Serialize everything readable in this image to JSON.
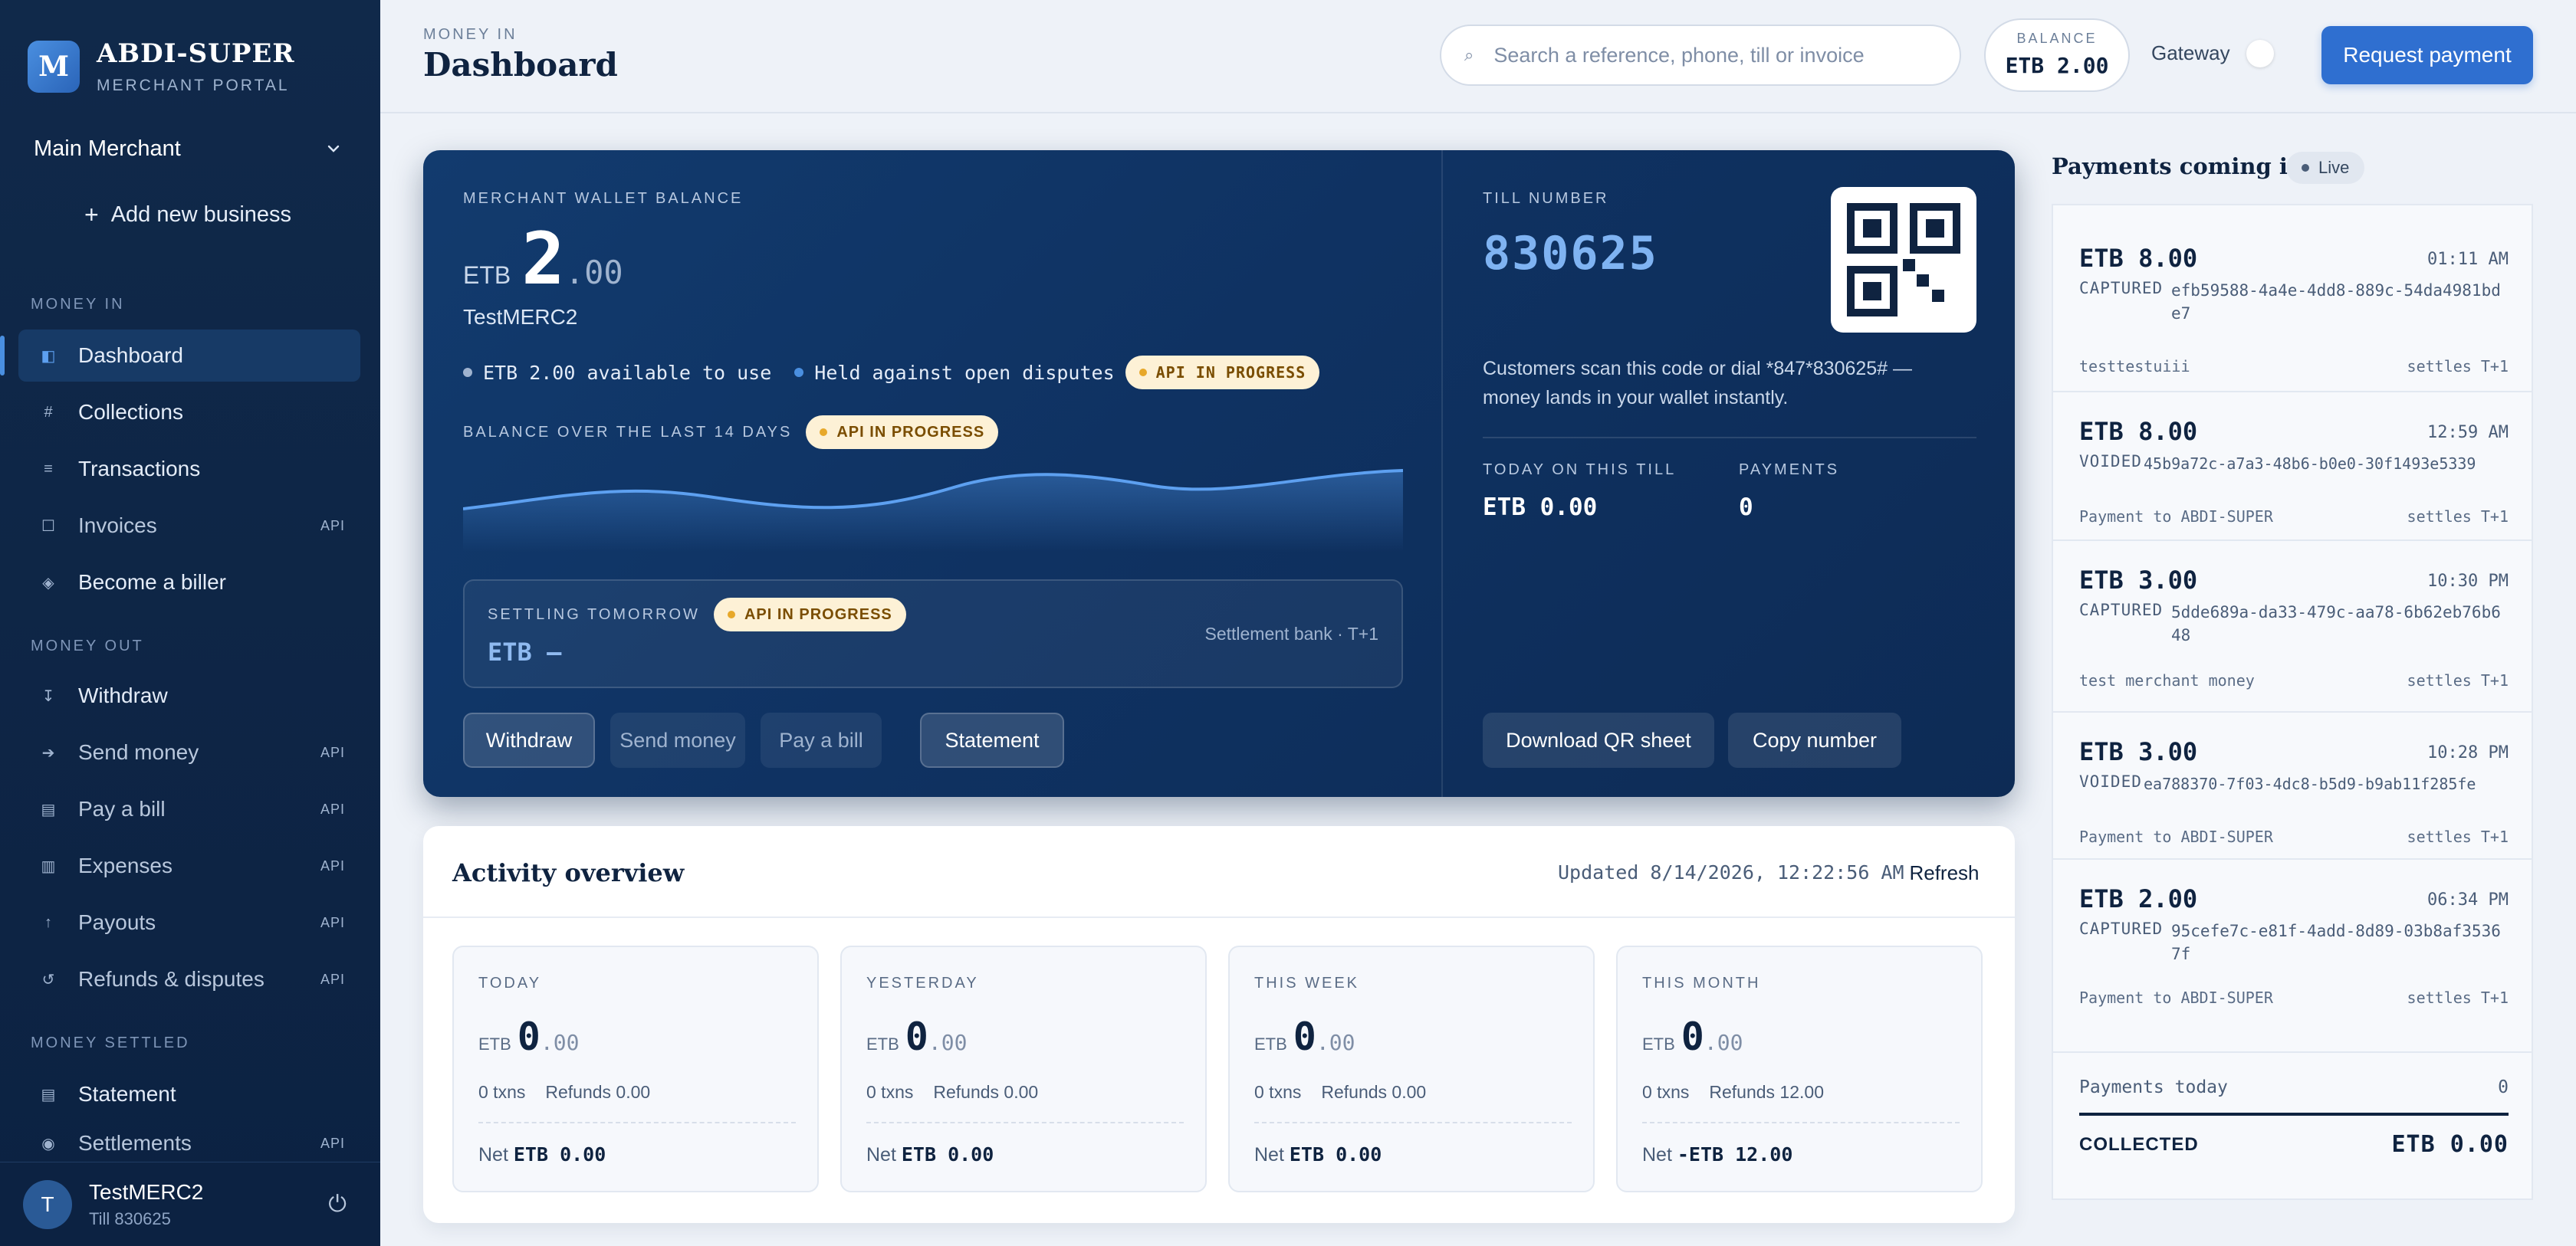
{
  "sidebar": {
    "brand_initial": "M",
    "brand_name": "ABDI-SUPER",
    "brand_sub": "MERCHANT PORTAL",
    "merchant": "Main Merchant",
    "add_business": "Add new business",
    "sections": {
      "money_in": "MONEY IN",
      "money_out": "MONEY OUT",
      "money_settled": "MONEY SETTLED"
    },
    "items": [
      {
        "label": "Dashboard",
        "badge": ""
      },
      {
        "label": "Collections",
        "badge": ""
      },
      {
        "label": "Transactions",
        "badge": ""
      },
      {
        "label": "Invoices",
        "badge": "API"
      },
      {
        "label": "Become a biller",
        "badge": ""
      },
      {
        "label": "Withdraw",
        "badge": ""
      },
      {
        "label": "Send money",
        "badge": "API"
      },
      {
        "label": "Pay a bill",
        "badge": "API"
      },
      {
        "label": "Expenses",
        "badge": "API"
      },
      {
        "label": "Payouts",
        "badge": "API"
      },
      {
        "label": "Refunds & disputes",
        "badge": "API"
      },
      {
        "label": "Statement",
        "badge": ""
      },
      {
        "label": "Settlements",
        "badge": "API"
      }
    ],
    "user": {
      "initial": "T",
      "name": "TestMERC2",
      "till": "Till 830625"
    }
  },
  "header": {
    "crumb": "MONEY IN",
    "title": "Dashboard",
    "search_placeholder": "Search a reference, phone, till or invoice",
    "balance_label": "BALANCE",
    "balance_value": "ETB 2.00",
    "gateway_label": "Gateway",
    "request_button": "Request payment"
  },
  "hero": {
    "wallet_label": "MERCHANT WALLET BALANCE",
    "currency": "ETB",
    "amount_int": "2",
    "amount_dec": ".00",
    "merchant_name": "TestMERC2",
    "available": "ETB 2.00 available to use",
    "held": "Held against open disputes",
    "api_badge": "API IN PROGRESS",
    "chart_label": "BALANCE OVER THE LAST 14 DAYS",
    "settling_label": "SETTLING TOMORROW",
    "settling_value": "ETB —",
    "settling_meta": "Settlement bank · T+1",
    "buttons": [
      "Withdraw",
      "Send money",
      "Pay a bill",
      "Statement"
    ],
    "till_label": "TILL NUMBER",
    "till_number": "830625",
    "till_desc": "Customers scan this code or dial *847*830625# — money lands in your wallet instantly.",
    "today_label": "TODAY ON THIS TILL",
    "today_value": "ETB 0.00",
    "payments_label": "PAYMENTS",
    "payments_value": "0",
    "till_buttons": [
      "Download QR sheet",
      "Copy number"
    ]
  },
  "activity": {
    "title": "Activity overview",
    "updated": "Updated 8/14/2026, 12:22:56 AM",
    "refresh": "Refresh",
    "cards": [
      {
        "label": "TODAY",
        "currency": "ETB",
        "int": "0",
        "dec": ".00",
        "txns": "0 txns",
        "refunds": "Refunds 0.00",
        "net_label": "Net",
        "net": "ETB 0.00"
      },
      {
        "label": "YESTERDAY",
        "currency": "ETB",
        "int": "0",
        "dec": ".00",
        "txns": "0 txns",
        "refunds": "Refunds 0.00",
        "net_label": "Net",
        "net": "ETB 0.00"
      },
      {
        "label": "THIS WEEK",
        "currency": "ETB",
        "int": "0",
        "dec": ".00",
        "txns": "0 txns",
        "refunds": "Refunds 0.00",
        "net_label": "Net",
        "net": "ETB 0.00"
      },
      {
        "label": "THIS MONTH",
        "currency": "ETB",
        "int": "0",
        "dec": ".00",
        "txns": "0 txns",
        "refunds": "Refunds 12.00",
        "net_label": "Net",
        "net": "-ETB 12.00"
      }
    ]
  },
  "feed": {
    "title": "Payments coming in",
    "live": "Live",
    "items": [
      {
        "amount": "ETB 8.00",
        "time": "01:11 AM",
        "status": "CAPTURED",
        "id": "efb59588-4a4e-4dd8-889c-54da4981bde7",
        "note": "testtestuiii",
        "settles": "settles T+1"
      },
      {
        "amount": "ETB 8.00",
        "time": "12:59 AM",
        "status": "VOIDED",
        "id": "45b9a72c-a7a3-48b6-b0e0-30f1493e5339",
        "note": "Payment to ABDI-SUPER",
        "settles": "settles T+1"
      },
      {
        "amount": "ETB 3.00",
        "time": "10:30 PM",
        "status": "CAPTURED",
        "id": "5dde689a-da33-479c-aa78-6b62eb76b648",
        "note": "test merchant money",
        "settles": "settles T+1"
      },
      {
        "amount": "ETB 3.00",
        "time": "10:28 PM",
        "status": "VOIDED",
        "id": "ea788370-7f03-4dc8-b5d9-b9ab11f285fe",
        "note": "Payment to ABDI-SUPER",
        "settles": "settles T+1"
      },
      {
        "amount": "ETB 2.00",
        "time": "06:34 PM",
        "status": "CAPTURED",
        "id": "95cefe7c-e81f-4add-8d89-03b8af35367f",
        "note": "Payment to ABDI-SUPER",
        "settles": "settles T+1"
      }
    ],
    "today_label": "Payments today",
    "today_value": "0",
    "collected_label": "COLLECTED",
    "collected_value": "ETB 0.00"
  },
  "colors": {
    "accent": "#2f6fd0",
    "sidebar": "#10294a",
    "hero": "#123b6e",
    "badge": "#fdf1d6"
  }
}
